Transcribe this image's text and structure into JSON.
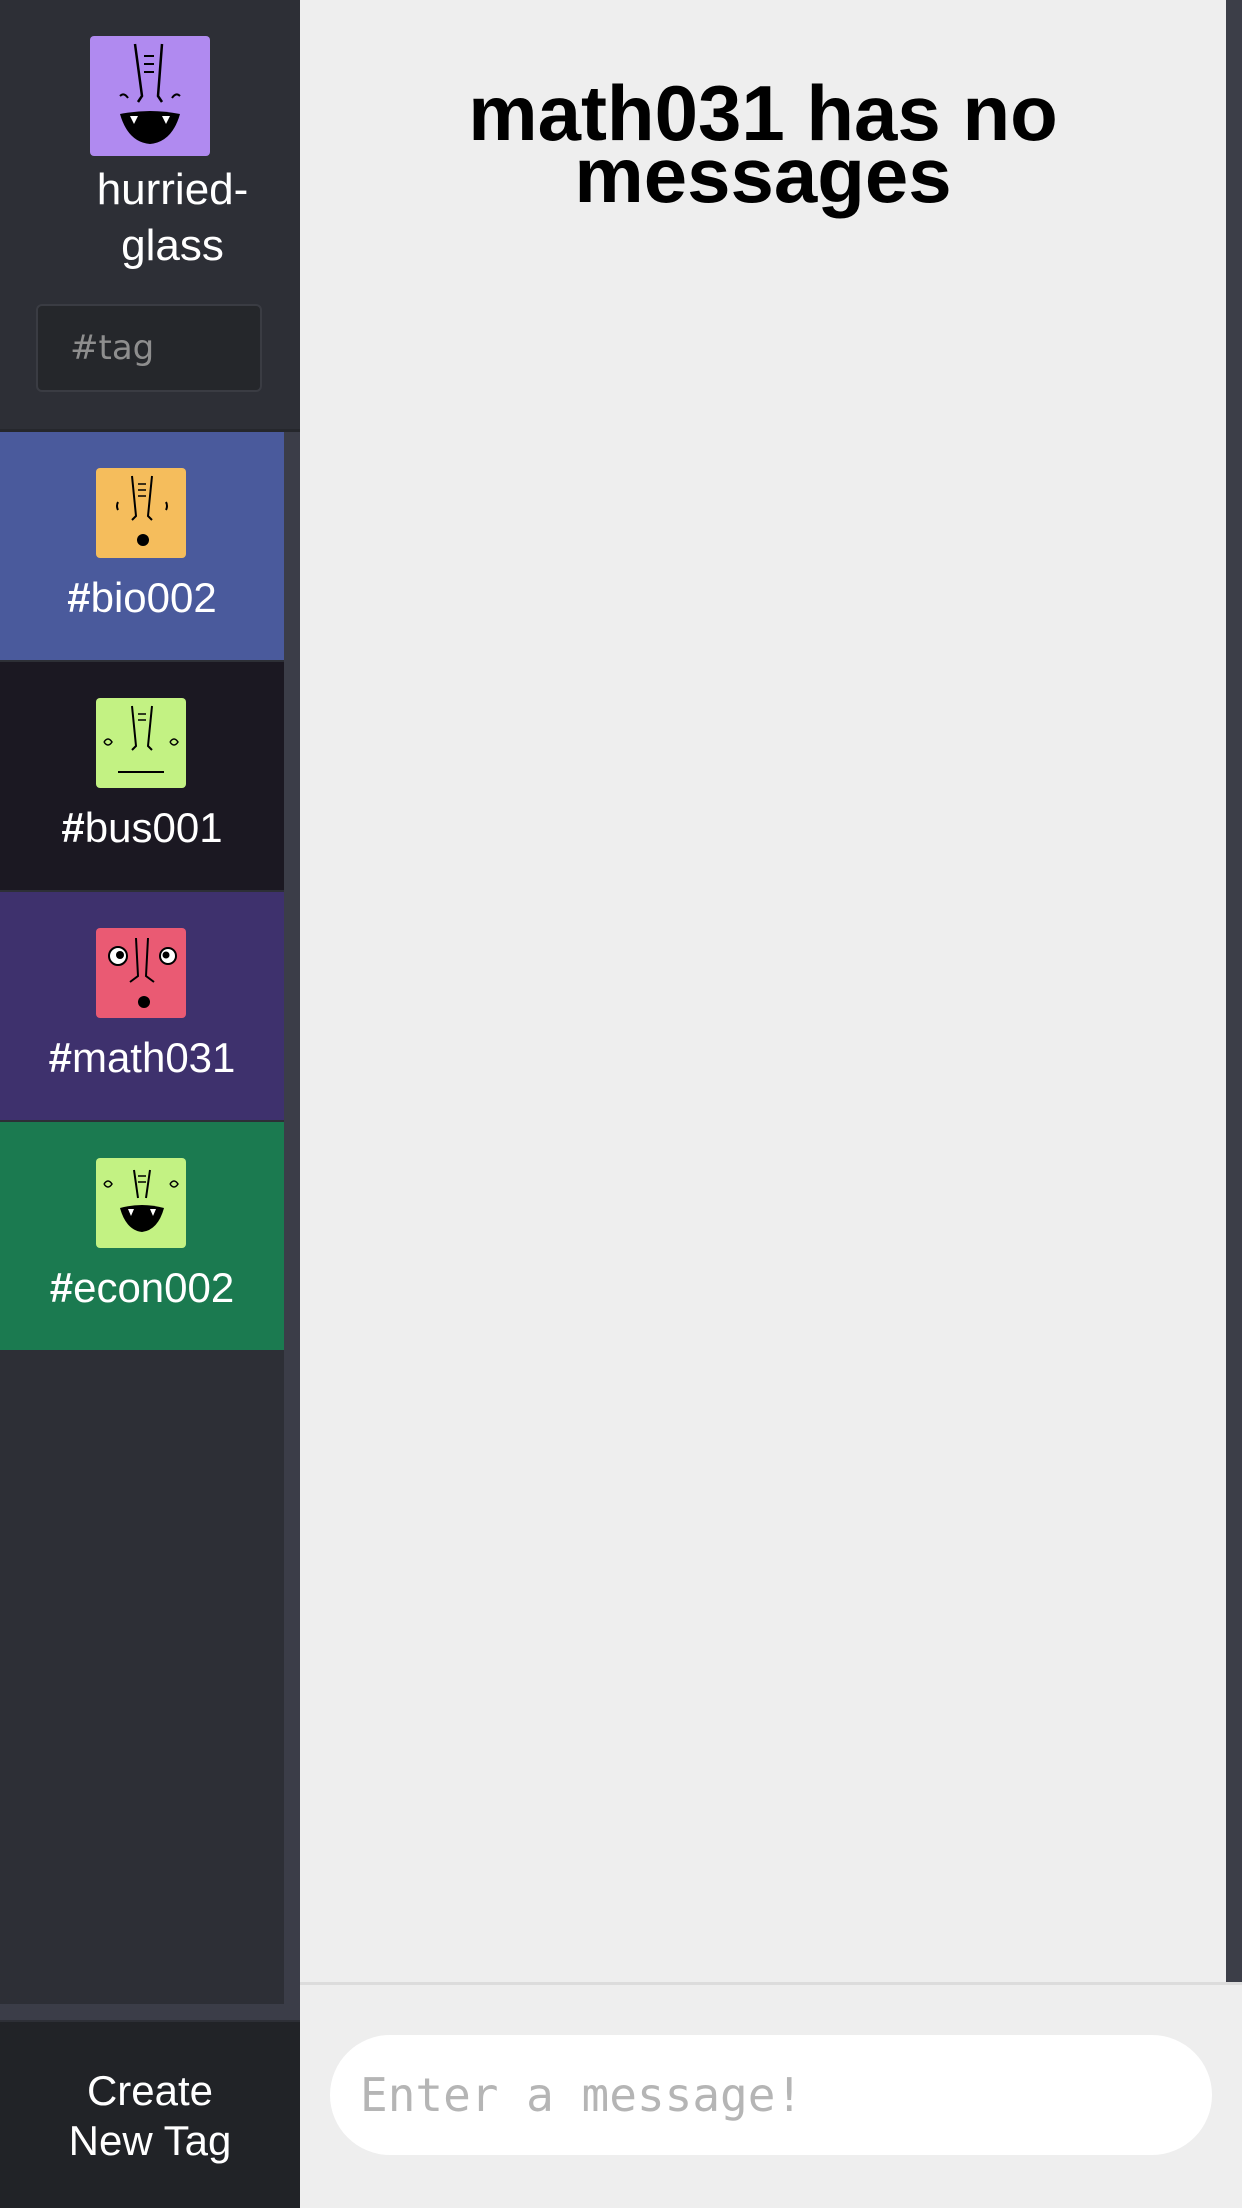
{
  "user": {
    "name": "hurried-glass",
    "avatar_icon": "monster-face-icon",
    "avatar_color": "#b08af0"
  },
  "search": {
    "placeholder": "#tag"
  },
  "tags": [
    {
      "hash": "#",
      "name": "bio002",
      "bg": "#4a5a9c",
      "avatar_color": "#f5bd5c",
      "icon": "monster-face-icon"
    },
    {
      "hash": "#",
      "name": "bus001",
      "bg": "#1b1822",
      "avatar_color": "#c3f283",
      "icon": "monster-face-icon"
    },
    {
      "hash": "#",
      "name": "math031",
      "bg": "#3e316d",
      "avatar_color": "#ea5a73",
      "icon": "monster-face-icon"
    },
    {
      "hash": "#",
      "name": "econ002",
      "bg": "#1b7a50",
      "avatar_color": "#c3f283",
      "icon": "monster-face-icon"
    }
  ],
  "create_tag": {
    "line1": "Create",
    "line2": "New Tag"
  },
  "main": {
    "title_line1": "math031 has no",
    "title_line2": "messages"
  },
  "composer": {
    "placeholder": "Enter a message!"
  }
}
